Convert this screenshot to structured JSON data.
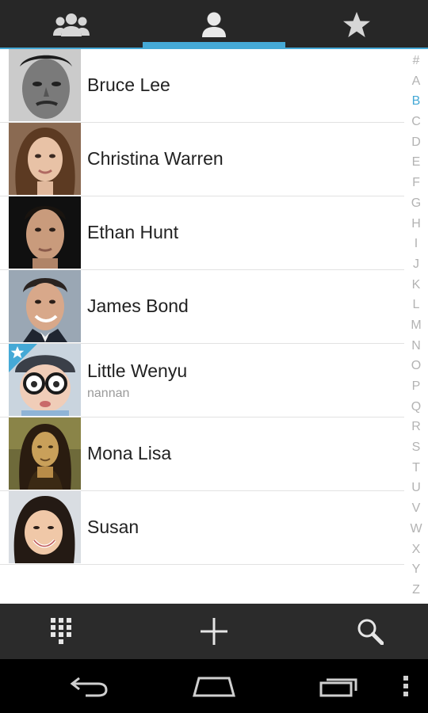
{
  "tabs": [
    {
      "icon": "groups-icon",
      "selected": false
    },
    {
      "icon": "person-icon",
      "selected": true
    },
    {
      "icon": "star-icon",
      "selected": false
    }
  ],
  "colors": {
    "accent": "#45a9d6",
    "tabbar_bg": "#272727",
    "actionbar_bg": "#2b2b2b",
    "navbar_bg": "#000000"
  },
  "contacts": [
    {
      "name": "Bruce Lee",
      "subtitle": "",
      "favorite": false
    },
    {
      "name": "Christina Warren",
      "subtitle": "",
      "favorite": false
    },
    {
      "name": "Ethan Hunt",
      "subtitle": "",
      "favorite": false
    },
    {
      "name": "James Bond",
      "subtitle": "",
      "favorite": false
    },
    {
      "name": "Little Wenyu",
      "subtitle": "nannan",
      "favorite": true
    },
    {
      "name": "Mona Lisa",
      "subtitle": "",
      "favorite": false
    },
    {
      "name": "Susan",
      "subtitle": "",
      "favorite": false
    }
  ],
  "index_letters": [
    "#",
    "A",
    "B",
    "C",
    "D",
    "E",
    "F",
    "G",
    "H",
    "I",
    "J",
    "K",
    "L",
    "M",
    "N",
    "O",
    "P",
    "Q",
    "R",
    "S",
    "T",
    "U",
    "V",
    "W",
    "X",
    "Y",
    "Z"
  ],
  "index_active": "B",
  "actions": [
    {
      "icon": "dialpad-icon"
    },
    {
      "icon": "add-icon"
    },
    {
      "icon": "search-icon"
    }
  ],
  "navigation": [
    {
      "icon": "back-icon"
    },
    {
      "icon": "home-icon"
    },
    {
      "icon": "recent-apps-icon"
    },
    {
      "icon": "menu-icon"
    }
  ]
}
